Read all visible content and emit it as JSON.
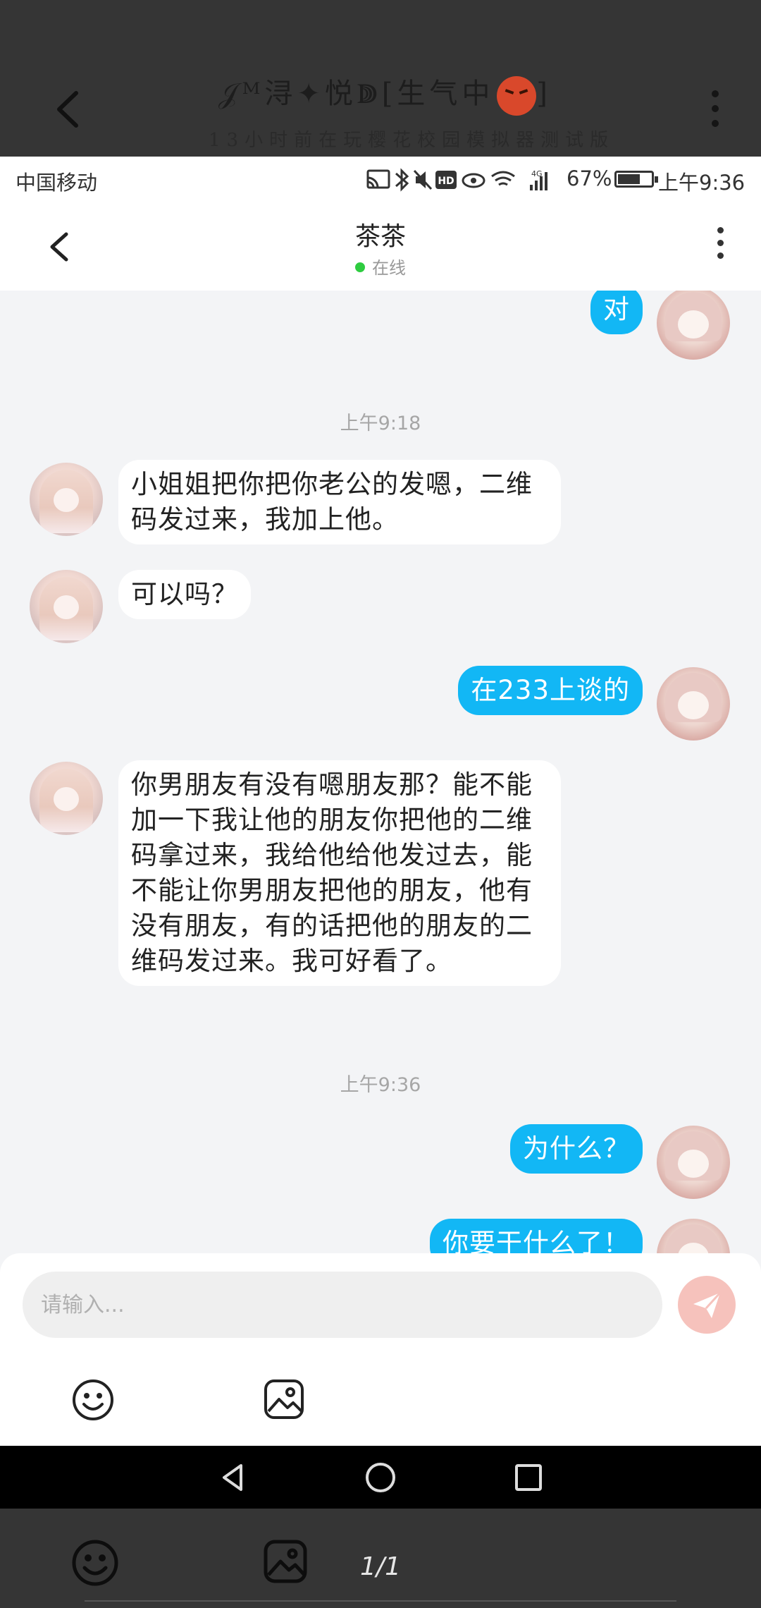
{
  "viewer": {
    "title": "𝒥ᴹ浔✦悦ↇ[生气中",
    "title_end": "]",
    "subtitle": "13小时前在玩樱花校园模拟器测试版",
    "page_indicator": "1/1"
  },
  "status_bar": {
    "carrier": "中国移动",
    "battery_percent": "67%",
    "battery_level": 0.67,
    "time": "上午9:36",
    "network": "4G"
  },
  "chat_header": {
    "contact_name": "茶茶",
    "status": "在线"
  },
  "messages": [
    {
      "from": "me",
      "text": "对"
    },
    {
      "type": "time",
      "text": "上午9:18"
    },
    {
      "from": "them",
      "text": "小姐姐把你把你老公的发嗯，二维码发过来，我加上他。"
    },
    {
      "from": "them",
      "text": "可以吗？"
    },
    {
      "from": "me",
      "text": "在233上谈的"
    },
    {
      "from": "them",
      "text": "你男朋友有没有嗯朋友那？能不能加一下我让他的朋友你把他的二维码拿过来，我给他给他发过去，能不能让你男朋友把他的朋友，他有没有朋友，有的话把他的朋友的二维码发过来。我可好看了。"
    },
    {
      "type": "time",
      "text": "上午9:36"
    },
    {
      "from": "me",
      "text": "为什么？"
    },
    {
      "from": "me",
      "text": "你要干什么了！"
    }
  ],
  "composer": {
    "placeholder": "请输入..."
  },
  "colors": {
    "outgoing_bubble": "#12b7f5",
    "incoming_bubble": "#ffffff",
    "online_dot": "#2ecc40",
    "send_button": "#f6c2bc"
  },
  "icons": [
    "back-icon",
    "more-vertical-icon",
    "emoji-icon",
    "image-icon",
    "send-icon",
    "nav-back-icon",
    "nav-home-icon",
    "nav-recents-icon"
  ]
}
